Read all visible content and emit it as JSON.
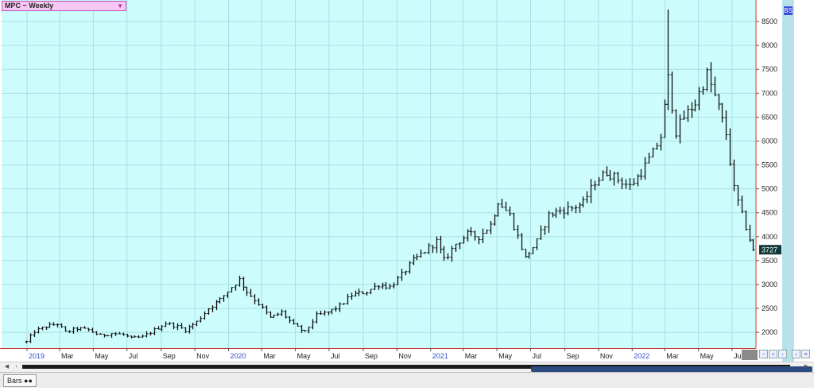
{
  "symbol": {
    "label": "MPC ~ Weekly"
  },
  "badge": {
    "text": "BS"
  },
  "status": {
    "tab_label": "Bars"
  },
  "colors": {
    "plot_bg": "#ccfdfc",
    "grid": "#a8dfe6",
    "bars": "#111111",
    "axis_line": "#d03030",
    "year_label": "#2f4fd0",
    "last_price_bg": "#123838"
  },
  "chart_data": {
    "type": "bar",
    "title": "MPC ~ Weekly",
    "ylim": [
      1670,
      8950
    ],
    "y_ticks": [
      2000,
      2500,
      3000,
      3500,
      4000,
      4500,
      5000,
      5500,
      6000,
      6500,
      7000,
      7500,
      8000,
      8500
    ],
    "y_tick_labels": [
      "2000",
      "2500",
      "3000",
      "3500",
      "4000",
      "4500",
      "5000",
      "5500",
      "6000",
      "6500",
      "7000",
      "7500",
      "8000",
      "8500"
    ],
    "last_price": 3727,
    "last_price_label": "3727",
    "x_labels": [
      {
        "label": "2019",
        "year": true
      },
      {
        "label": "Mar",
        "year": false
      },
      {
        "label": "May",
        "year": false
      },
      {
        "label": "Jul",
        "year": false
      },
      {
        "label": "Sep",
        "year": false
      },
      {
        "label": "Nov",
        "year": false
      },
      {
        "label": "2020",
        "year": true
      },
      {
        "label": "Mar",
        "year": false
      },
      {
        "label": "May",
        "year": false
      },
      {
        "label": "Jul",
        "year": false
      },
      {
        "label": "Sep",
        "year": false
      },
      {
        "label": "Nov",
        "year": false
      },
      {
        "label": "2021",
        "year": true
      },
      {
        "label": "Mar",
        "year": false
      },
      {
        "label": "May",
        "year": false
      },
      {
        "label": "Jul",
        "year": false
      },
      {
        "label": "Sep",
        "year": false
      },
      {
        "label": "Nov",
        "year": false
      },
      {
        "label": "2022",
        "year": true
      },
      {
        "label": "Mar",
        "year": false
      },
      {
        "label": "May",
        "year": false
      },
      {
        "label": "Jul",
        "year": false
      }
    ],
    "price_path": [
      [
        "2018-12-31",
        1800
      ],
      [
        "2019-01-14",
        2020
      ],
      [
        "2019-02-04",
        2120
      ],
      [
        "2019-02-25",
        2180
      ],
      [
        "2019-03-11",
        2000
      ],
      [
        "2019-04-01",
        2080
      ],
      [
        "2019-04-22",
        2050
      ],
      [
        "2019-05-13",
        1930
      ],
      [
        "2019-06-03",
        1980
      ],
      [
        "2019-06-24",
        1950
      ],
      [
        "2019-07-08",
        1870
      ],
      [
        "2019-07-29",
        1900
      ],
      [
        "2019-08-19",
        2050
      ],
      [
        "2019-09-09",
        2190
      ],
      [
        "2019-09-30",
        2120
      ],
      [
        "2019-10-14",
        2050
      ],
      [
        "2019-11-04",
        2220
      ],
      [
        "2019-11-25",
        2500
      ],
      [
        "2019-12-16",
        2680
      ],
      [
        "2020-01-06",
        2950
      ],
      [
        "2020-01-20",
        3100
      ],
      [
        "2020-02-03",
        2850
      ],
      [
        "2020-02-24",
        2600
      ],
      [
        "2020-03-16",
        2300
      ],
      [
        "2020-04-06",
        2420
      ],
      [
        "2020-04-27",
        2150
      ],
      [
        "2020-05-18",
        2000
      ],
      [
        "2020-06-08",
        2350
      ],
      [
        "2020-06-29",
        2420
      ],
      [
        "2020-07-20",
        2550
      ],
      [
        "2020-08-10",
        2780
      ],
      [
        "2020-09-07",
        2850
      ],
      [
        "2020-09-28",
        3000
      ],
      [
        "2020-10-19",
        2950
      ],
      [
        "2020-11-09",
        3200
      ],
      [
        "2020-11-30",
        3500
      ],
      [
        "2020-12-21",
        3700
      ],
      [
        "2021-01-11",
        3900
      ],
      [
        "2021-01-25",
        3500
      ],
      [
        "2021-02-15",
        3850
      ],
      [
        "2021-03-08",
        4050
      ],
      [
        "2021-03-29",
        4000
      ],
      [
        "2021-04-19",
        4250
      ],
      [
        "2021-05-03",
        4750
      ],
      [
        "2021-05-24",
        4450
      ],
      [
        "2021-06-07",
        4000
      ],
      [
        "2021-06-21",
        3550
      ],
      [
        "2021-07-12",
        3900
      ],
      [
        "2021-08-02",
        4450
      ],
      [
        "2021-08-23",
        4550
      ],
      [
        "2021-09-13",
        4600
      ],
      [
        "2021-10-04",
        4700
      ],
      [
        "2021-10-25",
        5150
      ],
      [
        "2021-11-15",
        5350
      ],
      [
        "2021-12-06",
        5200
      ],
      [
        "2021-12-27",
        5050
      ],
      [
        "2022-01-17",
        5350
      ],
      [
        "2022-02-07",
        5750
      ],
      [
        "2022-02-21",
        6100
      ],
      [
        "2022-03-07",
        7300
      ],
      [
        "2022-03-21",
        6200
      ],
      [
        "2022-04-04",
        6500
      ],
      [
        "2022-04-25",
        6800
      ],
      [
        "2022-05-16",
        7400
      ],
      [
        "2022-06-06",
        6700
      ],
      [
        "2022-06-20",
        6150
      ],
      [
        "2022-07-04",
        5000
      ],
      [
        "2022-07-18",
        4450
      ],
      [
        "2022-08-01",
        3950
      ],
      [
        "2022-08-08",
        3727
      ]
    ]
  }
}
